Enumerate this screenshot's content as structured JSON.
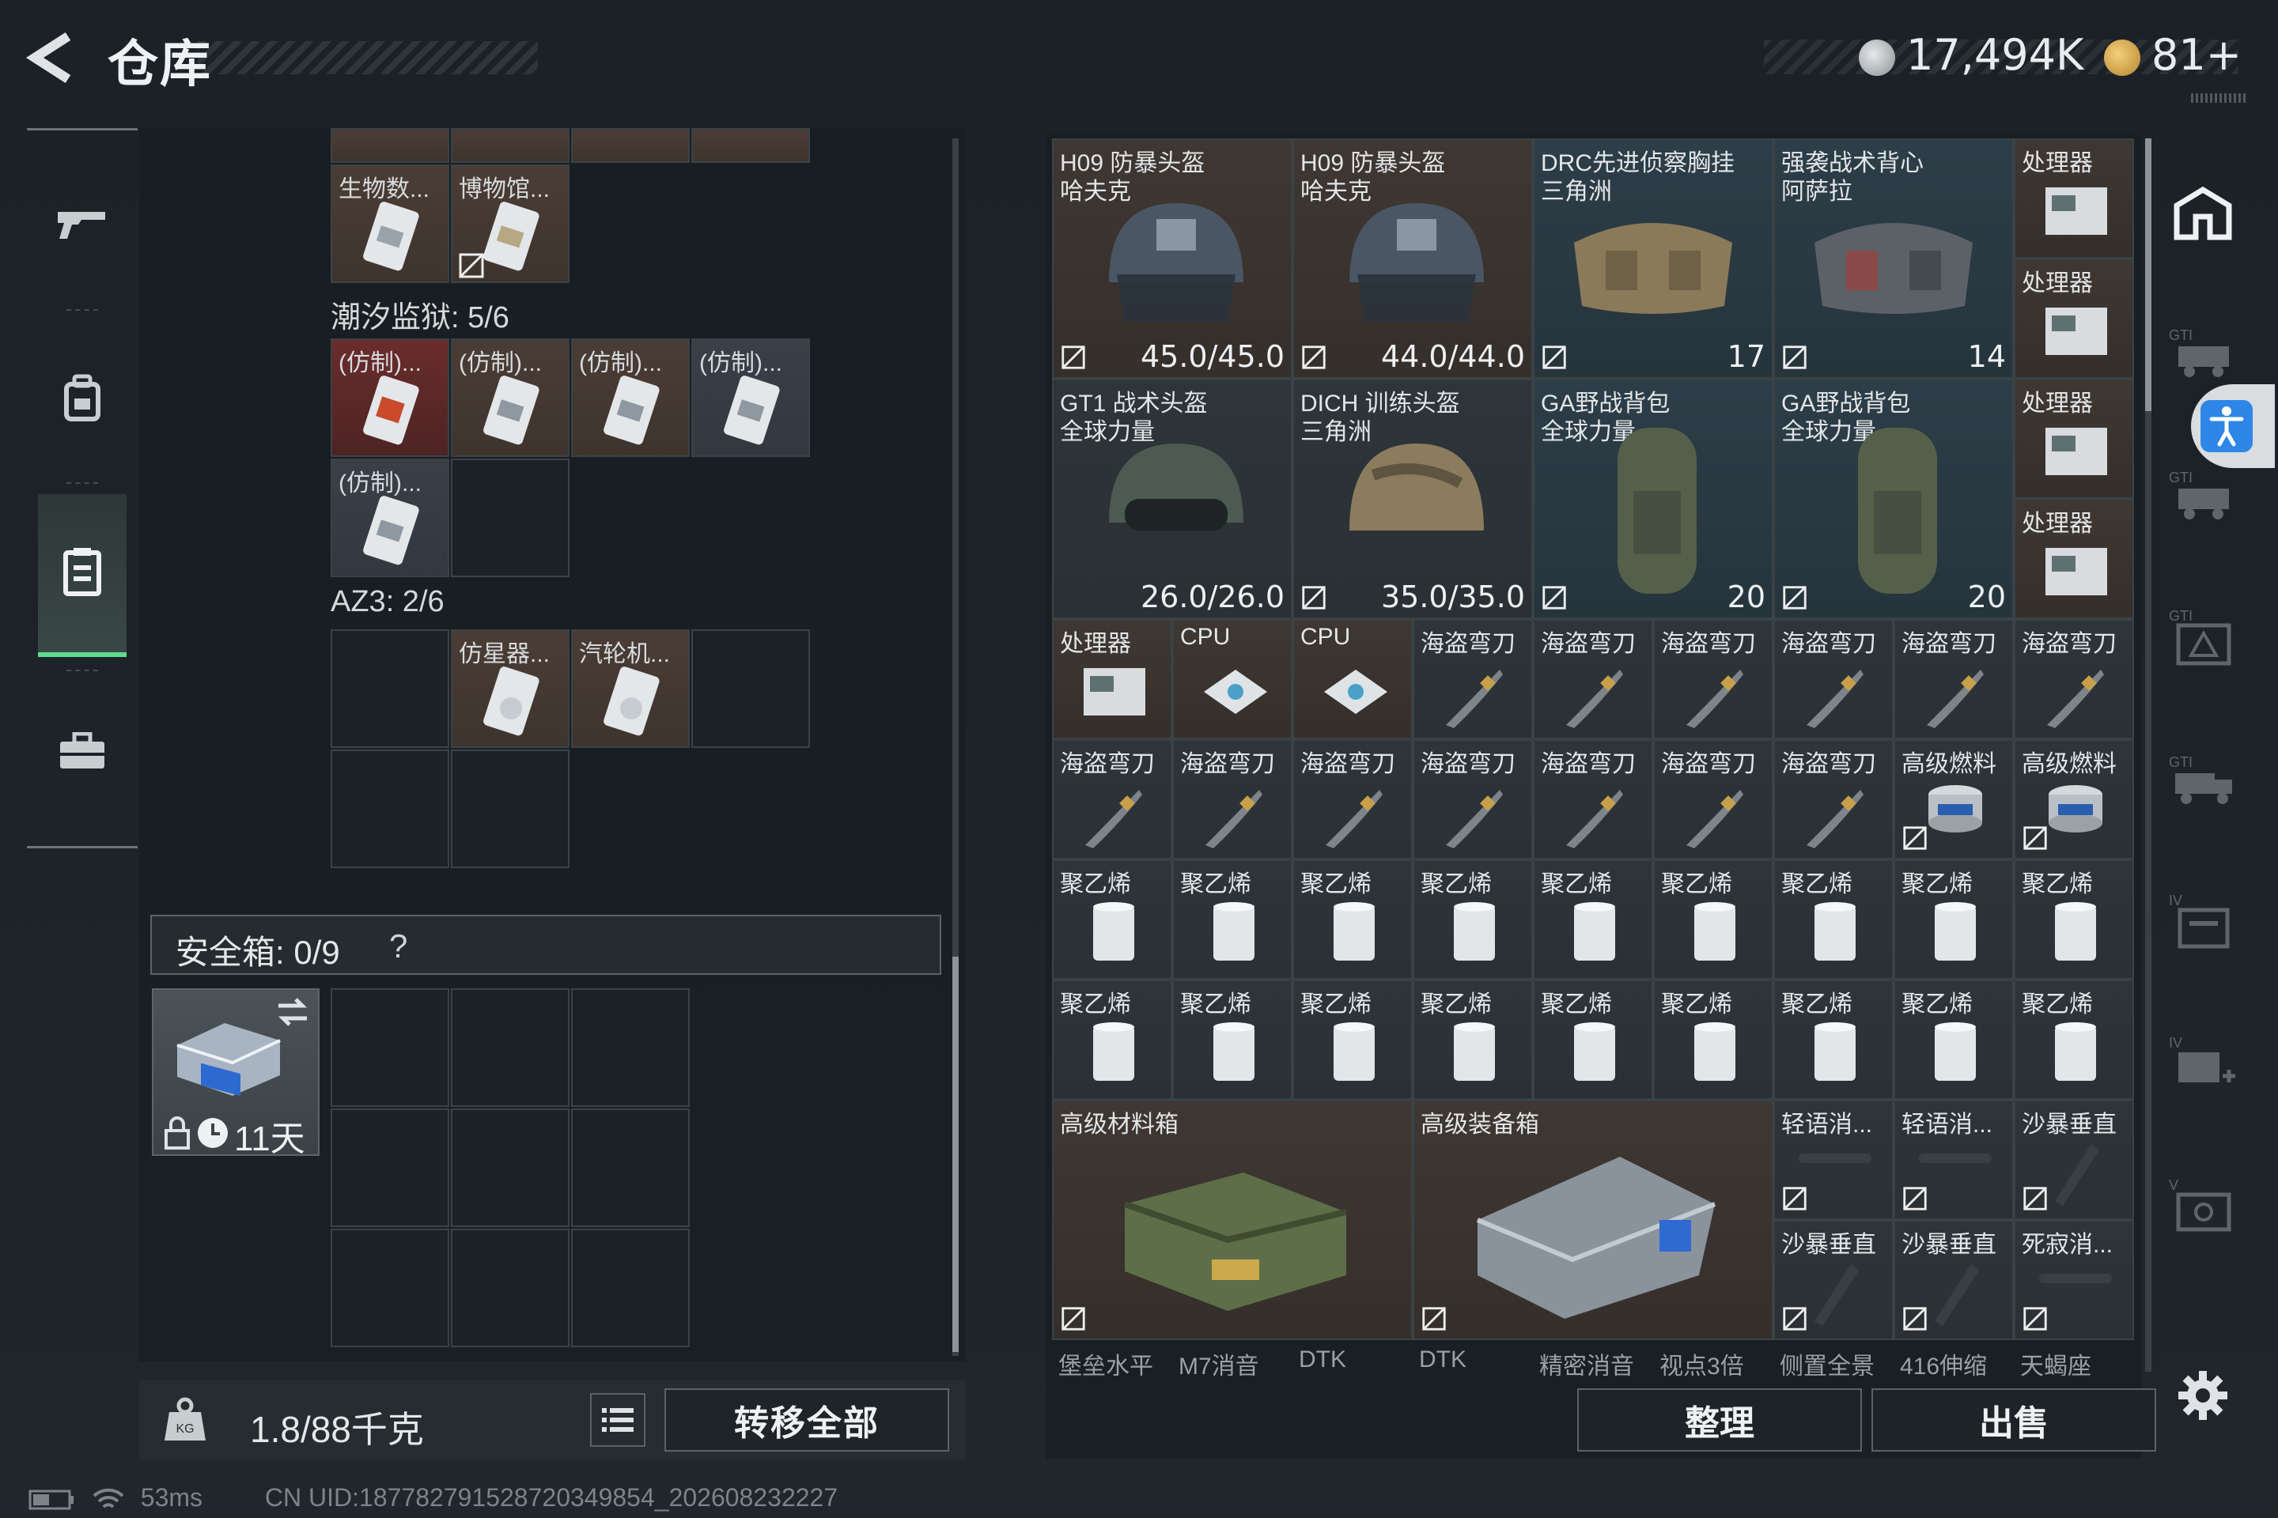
{
  "header": {
    "title": "仓库",
    "currency_a": "17,494K",
    "currency_b": "81+"
  },
  "nav": [
    {
      "name": "weapons",
      "icon": "gun-icon"
    },
    {
      "name": "equipment",
      "icon": "backpack-icon"
    },
    {
      "name": "storage",
      "icon": "locker-icon"
    },
    {
      "name": "case",
      "icon": "briefcase-icon"
    }
  ],
  "left_top_row": [
    {
      "label": "生物数..."
    },
    {
      "label": "博物馆..."
    }
  ],
  "section_tide": {
    "label": "潮汐监狱: 5/6"
  },
  "tide_cards": [
    {
      "label": "(仿制)..."
    },
    {
      "label": "(仿制)..."
    },
    {
      "label": "(仿制)..."
    },
    {
      "label": "(仿制)..."
    },
    {
      "label": "(仿制)..."
    }
  ],
  "section_az3": {
    "label": "AZ3: 2/6"
  },
  "az3_cards": [
    {
      "label": "仿星器..."
    },
    {
      "label": "汽轮机..."
    }
  ],
  "safebox": {
    "label": "安全箱: 0/9",
    "help": "?",
    "days": "11天"
  },
  "bottom": {
    "weight": "1.8/88千克",
    "transfer": "转移全部",
    "sort": "整理",
    "sell": "出售"
  },
  "status": {
    "ping": "53ms",
    "uid": "CN UID:18778279152872034985​4_202608232227"
  },
  "big_items": [
    {
      "label": "H09 防暴头盔",
      "sub": "哈夫克",
      "val": "45.0/45.0"
    },
    {
      "label": "H09 防暴头盔",
      "sub": "哈夫克",
      "val": "44.0/44.0"
    },
    {
      "label": "DRC先进侦察胸挂",
      "sub": "三角洲",
      "val": "17"
    },
    {
      "label": "强袭战术背心",
      "sub": "阿萨拉",
      "val": "14"
    },
    {
      "label": "GT1 战术头盔",
      "sub": "全球力量",
      "val": "26.0/26.0"
    },
    {
      "label": "DICH 训练头盔",
      "sub": "三角洲",
      "val": "35.0/35.0"
    },
    {
      "label": "GA野战背包",
      "sub": "全球力量",
      "val": "20"
    },
    {
      "label": "GA野战背包",
      "sub": "全球力量",
      "val": "20"
    }
  ],
  "processor_label": "处理器",
  "cpu_label": "CPU",
  "sabre_label": "海盗弯刀",
  "fuel_label": "高级燃料",
  "poly_label": "聚乙烯",
  "material_box": {
    "label": "高级材料箱"
  },
  "gear_box": {
    "label": "高级装备箱"
  },
  "small_attach": [
    {
      "label": "轻语消..."
    },
    {
      "label": "轻语消..."
    },
    {
      "label": "沙暴垂直"
    },
    {
      "label": "沙暴垂直"
    },
    {
      "label": "沙暴垂直"
    },
    {
      "label": "死寂消..."
    }
  ],
  "peek_row": [
    "堡垒水平",
    "M7消音",
    "DTK",
    "DTK",
    "精密消音",
    "视点3倍",
    "侧置全景",
    "416伸缩",
    "天蝎座"
  ],
  "rail": [
    "home-icon",
    "gti-vehicle-icon",
    "gti-vehicle-icon",
    "gti-tri-icon",
    "gti-truck-icon",
    "iv-box-icon",
    "iv-plus-icon",
    "v-box-icon"
  ]
}
